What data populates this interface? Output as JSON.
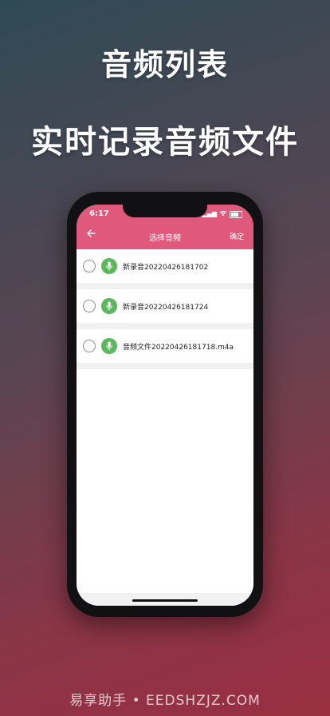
{
  "headline": {
    "line1": "音频列表",
    "line2": "实时记录音频文件"
  },
  "status_bar": {
    "time": "6:17",
    "icons": [
      "signal-icon",
      "wifi-icon",
      "battery-icon"
    ]
  },
  "nav": {
    "back_icon": "back-arrow-icon",
    "title": "选择音频",
    "confirm_label": "确定",
    "color": "#e0587b"
  },
  "audio_list": {
    "items": [
      {
        "name": "新录音20220426181702",
        "selected": false
      },
      {
        "name": "新录音20220426181724",
        "selected": false
      },
      {
        "name": "音频文件20220426181718.m4a",
        "selected": false
      }
    ],
    "icon": "microphone-icon",
    "icon_color": "#5ab85a"
  },
  "watermark": "易享助手 • EEDSHZJZ.COM"
}
